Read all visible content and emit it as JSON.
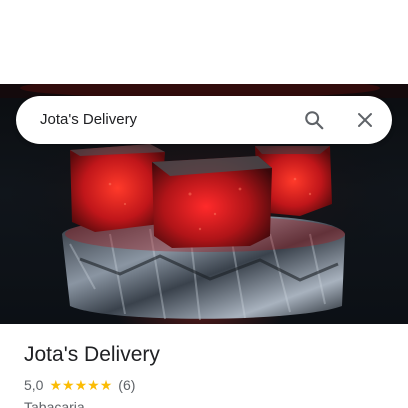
{
  "search": {
    "query": "Jota's Delivery"
  },
  "icons": {
    "search": "search-icon",
    "close": "close-icon",
    "star": "star-icon"
  },
  "place": {
    "name": "Jota's Delivery",
    "rating": "5,0",
    "stars": 5,
    "review_count": "(6)",
    "category": "Tabacaria"
  },
  "colors": {
    "star": "#fbbc04",
    "text_primary": "#202124",
    "text_secondary": "#5f6368"
  }
}
